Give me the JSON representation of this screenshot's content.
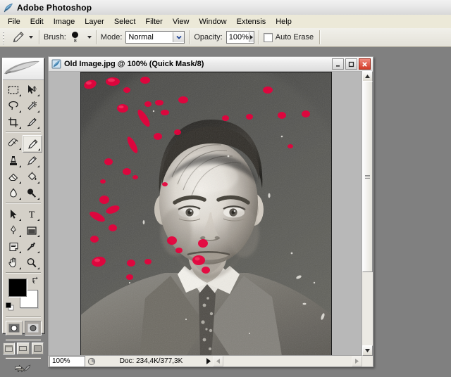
{
  "app": {
    "title": "Adobe Photoshop",
    "icon": "feather-icon",
    "menus": [
      {
        "label": "File",
        "accel": "F"
      },
      {
        "label": "Edit",
        "accel": "E"
      },
      {
        "label": "Image",
        "accel": "I"
      },
      {
        "label": "Layer",
        "accel": "L"
      },
      {
        "label": "Select",
        "accel": "S"
      },
      {
        "label": "Filter",
        "accel": "t"
      },
      {
        "label": "View",
        "accel": "V"
      },
      {
        "label": "Window",
        "accel": "W"
      },
      {
        "label": "Extensis",
        "accel": "x"
      },
      {
        "label": "Help",
        "accel": "H"
      }
    ]
  },
  "options_bar": {
    "active_tool_icon": "pencil-icon",
    "brush_label": "Brush:",
    "brush_size": "8",
    "mode_label": "Mode:",
    "mode_value": "Normal",
    "opacity_label": "Opacity:",
    "opacity_value": "100%",
    "auto_erase_label": "Auto Erase",
    "auto_erase_checked": false
  },
  "toolbox": {
    "tools": [
      {
        "name": "rectangular-marquee-icon",
        "selected": false
      },
      {
        "name": "move-icon",
        "selected": false
      },
      {
        "name": "lasso-icon",
        "selected": false
      },
      {
        "name": "magic-wand-icon",
        "selected": false
      },
      {
        "name": "crop-icon",
        "selected": false
      },
      {
        "name": "slice-icon",
        "selected": false
      },
      {
        "name": "healing-brush-icon",
        "selected": false
      },
      {
        "name": "pencil-icon",
        "selected": true
      },
      {
        "name": "clone-stamp-icon",
        "selected": false
      },
      {
        "name": "history-brush-icon",
        "selected": false
      },
      {
        "name": "eraser-icon",
        "selected": false
      },
      {
        "name": "paint-bucket-icon",
        "selected": false
      },
      {
        "name": "blur-icon",
        "selected": false
      },
      {
        "name": "dodge-icon",
        "selected": false
      },
      {
        "name": "path-selection-icon",
        "selected": false
      },
      {
        "name": "type-icon",
        "selected": false
      },
      {
        "name": "pen-icon",
        "selected": false
      },
      {
        "name": "shape-icon",
        "selected": false
      },
      {
        "name": "notes-icon",
        "selected": false
      },
      {
        "name": "eyedropper-icon",
        "selected": false
      },
      {
        "name": "hand-icon",
        "selected": false
      },
      {
        "name": "zoom-icon",
        "selected": false
      }
    ],
    "foreground_color": "#000000",
    "background_color": "#ffffff",
    "swap_colors_icon": "swap-colors-icon",
    "default_colors_icon": "default-colors-icon",
    "quick_mask": [
      {
        "name": "standard-mode-button",
        "active": false
      },
      {
        "name": "quick-mask-mode-button",
        "active": true
      }
    ],
    "screen_modes": [
      {
        "name": "standard-screen-mode-button",
        "active": true
      },
      {
        "name": "full-screen-menubar-mode-button",
        "active": false
      },
      {
        "name": "full-screen-mode-button",
        "active": false
      }
    ],
    "jump_to_icon": "jump-to-imageready-icon"
  },
  "document": {
    "icon": "document-icon",
    "title": "Old Image.jpg @ 100% (Quick Mask/8)",
    "window_buttons": [
      {
        "name": "minimize-button",
        "glyph": "_"
      },
      {
        "name": "maximize-button",
        "glyph": "□"
      },
      {
        "name": "close-button",
        "glyph": "✕"
      }
    ],
    "status": {
      "zoom": "100%",
      "preview_icon": "preview-icon",
      "doc_info": "Doc: 234,4K/377,3K",
      "expand_icon": "expand-arrow-icon"
    },
    "image": {
      "alt": "vintage black and white portrait photograph of a young man in a suit with red quick-mask spots",
      "quick_mask_color": "#e8003c"
    }
  }
}
